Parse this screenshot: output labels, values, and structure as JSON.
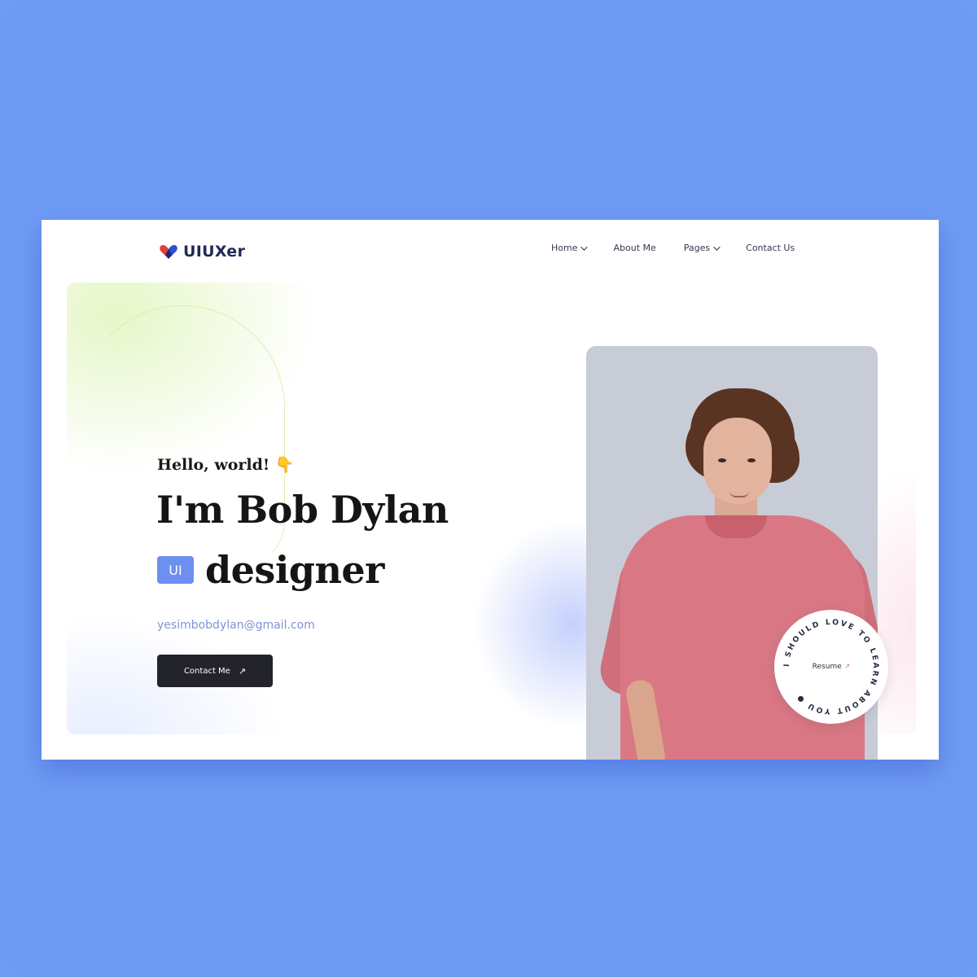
{
  "brand": {
    "name": "UIUXer"
  },
  "nav": {
    "items": [
      {
        "label": "Home",
        "has_dropdown": true
      },
      {
        "label": "About Me",
        "has_dropdown": false
      },
      {
        "label": "Pages",
        "has_dropdown": true
      },
      {
        "label": "Contact Us",
        "has_dropdown": false
      }
    ]
  },
  "hero": {
    "greeting": "Hello, world! 👇",
    "headline": "I'm Bob Dylan",
    "role_badge": "UI",
    "role": "designer",
    "email": "yesimbobdylan@gmail.com",
    "cta_label": "Contact Me",
    "cta_icon": "arrow-up-right-icon"
  },
  "resume_badge": {
    "label": "Resume",
    "ring_text": "I SHOULD LOVE TO LEARN ABOUT YOU ● ",
    "accent": "#e2786a"
  },
  "colors": {
    "background": "#6f9cf2",
    "primary_text": "#151515",
    "accent_blue": "#6d8ff0",
    "email_text": "#7f93d6",
    "cta_bg": "#23232b",
    "shirt": "#d97884"
  }
}
